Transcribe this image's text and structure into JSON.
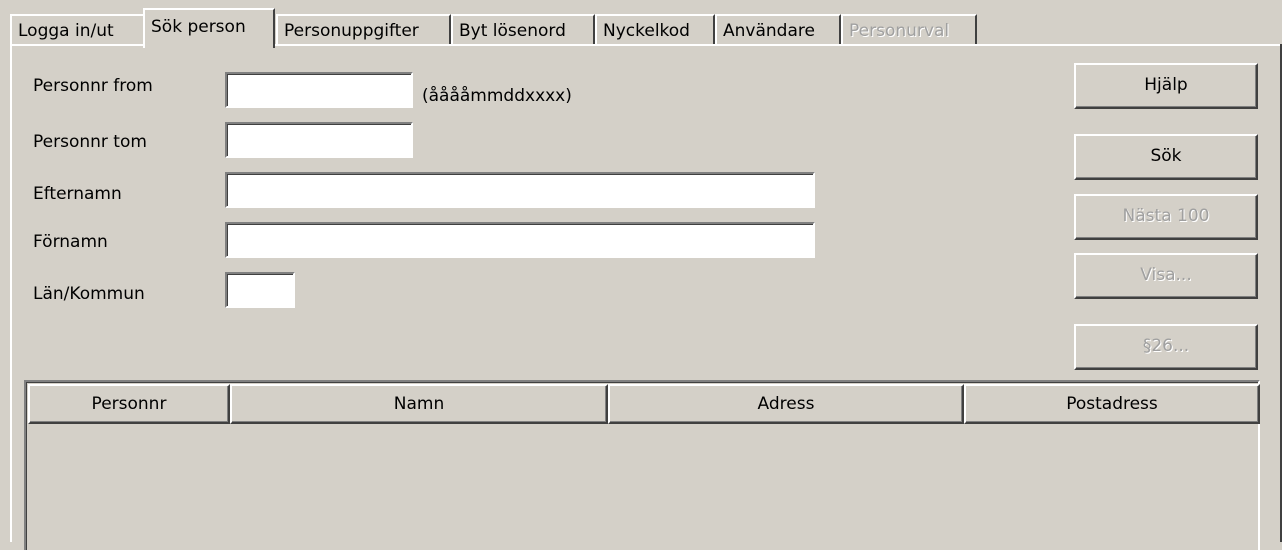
{
  "tabs": [
    {
      "label": "Logga in/ut",
      "state": "normal"
    },
    {
      "label": "Sök person",
      "state": "active"
    },
    {
      "label": "Personuppgifter",
      "state": "normal"
    },
    {
      "label": "Byt lösenord",
      "state": "normal"
    },
    {
      "label": "Nyckelkod",
      "state": "normal"
    },
    {
      "label": "Användare",
      "state": "normal"
    },
    {
      "label": "Personurval",
      "state": "disabled"
    }
  ],
  "form": {
    "personnr_from_label": "Personnr from",
    "personnr_from_value": "",
    "personnr_format_hint": "(ååååmmddxxxx)",
    "personnr_tom_label": "Personnr tom",
    "personnr_tom_value": "",
    "efternamn_label": "Efternamn",
    "efternamn_value": "",
    "fornamn_label": "Förnamn",
    "fornamn_value": "",
    "lan_kommun_label": "Län/Kommun",
    "lan_kommun_value": ""
  },
  "buttons": {
    "help": {
      "label": "Hjälp",
      "enabled": true
    },
    "search": {
      "label": "Sök",
      "enabled": true
    },
    "next100": {
      "label": "Nästa 100",
      "enabled": false
    },
    "show": {
      "label": "Visa...",
      "enabled": false
    },
    "section26": {
      "label": "§26...",
      "enabled": false
    }
  },
  "results": {
    "columns": [
      "Personnr",
      "Namn",
      "Adress",
      "Postadress"
    ],
    "rows": []
  },
  "colors": {
    "face": "#d4d0c8",
    "disabled_text": "#a0a0a0",
    "field": "#ffffff"
  }
}
